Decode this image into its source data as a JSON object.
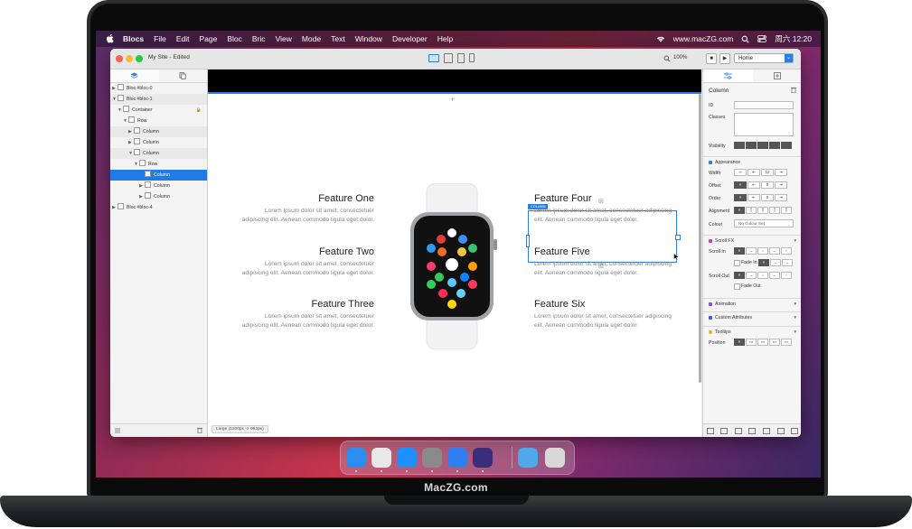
{
  "menubar": {
    "items": [
      "Blocs",
      "File",
      "Edit",
      "Page",
      "Bloc",
      "Bric",
      "View",
      "Mode",
      "Text",
      "Window",
      "Developer",
      "Help"
    ],
    "site": "www.macZG.com",
    "clock": "周六 12:20"
  },
  "window": {
    "title": "My Site - Edited",
    "zoom": "100%",
    "page_select": "Home"
  },
  "tree": [
    {
      "label": "Bloc #bloc-0",
      "indent": 0,
      "arrow": "▶",
      "style": "normal"
    },
    {
      "label": "Bloc #bloc-1",
      "indent": 0,
      "arrow": "▼",
      "style": "alt"
    },
    {
      "label": "Container",
      "indent": 1,
      "arrow": "▼",
      "style": "normal",
      "lock": true
    },
    {
      "label": "Row",
      "indent": 2,
      "arrow": "▼",
      "style": "normal"
    },
    {
      "label": "Column",
      "indent": 3,
      "arrow": "▶",
      "style": "alt"
    },
    {
      "label": "Column",
      "indent": 3,
      "arrow": "▶",
      "style": "normal"
    },
    {
      "label": "Column",
      "indent": 3,
      "arrow": "▼",
      "style": "alt"
    },
    {
      "label": "Row",
      "indent": 4,
      "arrow": "▼",
      "style": "normal"
    },
    {
      "label": "Column",
      "indent": 5,
      "arrow": "",
      "style": "sel"
    },
    {
      "label": "Column",
      "indent": 5,
      "arrow": "▶",
      "style": "normal"
    },
    {
      "label": "Column",
      "indent": 5,
      "arrow": "▶",
      "style": "normal"
    },
    {
      "label": "Bloc #bloc-4",
      "indent": 0,
      "arrow": "▶",
      "style": "normal"
    }
  ],
  "canvas": {
    "selection_tag": "COLUMN",
    "breakpoint": "Large (1200px -> 992px)",
    "features_left": [
      {
        "title": "Feature One",
        "body": "Lorem ipsum dolor sit amet, consectetuer adipiscing elit. Aenean commodo ligula eget dolor."
      },
      {
        "title": "Feature Two",
        "body": "Lorem ipsum dolor sit amet, consectetuer adipiscing elit. Aenean commodo ligula eget dolor."
      },
      {
        "title": "Feature Three",
        "body": "Lorem ipsum dolor sit amet, consectetuer adipiscing elit. Aenean commodo ligula eget dolor."
      }
    ],
    "features_right": [
      {
        "title": "Feature Four",
        "body": "Lorem ipsum dolor sit amet, consectetuer adipiscing elit. Aenean commodo ligula eget dolor."
      },
      {
        "title": "Feature Five",
        "body": "Lorem ipsum dolor sit amet, consectetuer adipiscing elit. Aenean commodo ligula eget dolor."
      },
      {
        "title": "Feature Six",
        "body": "Lorem ipsum dolor sit amet, consectetuer adipiscing elit. Aenean commodo ligula eget dolor."
      }
    ]
  },
  "inspector": {
    "title": "Column",
    "id_label": "ID",
    "classes_label": "Classes",
    "visibility_label": "Visibility",
    "appearance": "Appearance",
    "width_label": "Width",
    "width_value": "12",
    "offset_label": "Offset",
    "offset_value": "0",
    "order_label": "Order",
    "order_value": "0",
    "alignment_label": "Alignment",
    "colour_label": "Colour",
    "colour_value": "No Colour Set",
    "scrollfx": "Scroll FX",
    "scroll_in": "Scroll In",
    "fade_in": "Fade In",
    "scroll_out": "Scroll Out",
    "fade_out": "Fade Out",
    "animation": "Animation",
    "custom_attributes": "Custom Attributes",
    "tooltips": "Tooltips",
    "position_label": "Position",
    "colors": {
      "appearance": "#2b7de1",
      "scrollfx": "#d63aa8",
      "animation": "#8a4fd8",
      "custom": "#4a55d4",
      "tooltips": "#f0b020"
    }
  },
  "dock": {
    "apps": [
      {
        "icon": "finder-icon",
        "color": "#2d8cf0"
      },
      {
        "icon": "launchpad-icon",
        "color": "#e8e8e8"
      },
      {
        "icon": "safari-icon",
        "color": "#1e90ff"
      },
      {
        "icon": "system-preferences-icon",
        "color": "#8a8a8a"
      },
      {
        "icon": "mail-icon",
        "color": "#2f7ff0"
      },
      {
        "icon": "blocs-icon",
        "color": "#3a2e7c"
      },
      {
        "icon": "folder-icon",
        "color": "#4fa8e8"
      },
      {
        "icon": "trash-icon",
        "color": "#d8d8d8"
      }
    ]
  },
  "laptop_brand": "MacZG.com"
}
